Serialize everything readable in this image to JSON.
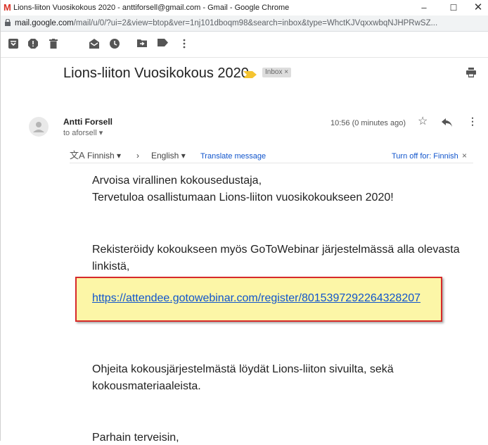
{
  "window": {
    "title": "Lions-liiton Vuosikokous 2020 - anttiforsell@gmail.com - Gmail - Google Chrome",
    "logo_letter": "M",
    "minimize": "–",
    "maximize": "☐",
    "close": "✕"
  },
  "address": {
    "domain": "mail.google.com",
    "path": "/mail/u/0/?ui=2&view=btop&ver=1nj101dboqm98&search=inbox&type=WhctKJVqxxwbqNJHPRwSZ..."
  },
  "toolbar": {
    "icons": [
      "archive-icon",
      "report-spam-icon",
      "delete-icon",
      "mark-unread-icon",
      "snooze-icon",
      "move-to-icon",
      "label-icon",
      "more-vert-icon"
    ]
  },
  "message": {
    "subject": "Lions-liiton Vuosikokous 2020",
    "label_chip": "Inbox ×",
    "sender": "Antti Forsell",
    "recipient": "to aforsell ▾",
    "time": "10:56 (0 minutes ago)",
    "star": "☆",
    "more": "⋮"
  },
  "translate": {
    "icon": "文A",
    "from_lang": "Finnish ▾",
    "arrow": "›",
    "to_lang": "English ▾",
    "translate_link": "Translate message",
    "turn_off": "Turn off for: Finnish",
    "close": "×"
  },
  "body": {
    "line1": "Arvoisa virallinen kokousedustaja,",
    "line2": "Tervetuloa osallistumaan Lions-liiton vuosikokoukseen 2020!",
    "line3": "Rekisteröidy kokoukseen myös GoToWebinar järjestelmässä alla olevasta",
    "line4": "linkistä,",
    "link": "https://attendee.gotowebinar.com/register/8015397292264328207",
    "line5": "Ohjeita kokousjärjestelmästä löydät Lions-liiton sivuilta, sekä",
    "line6": "kokousmateriaaleista.",
    "line7": "Parhain terveisin,"
  },
  "colors": {
    "link": "#1155cc",
    "highlight_fill": "#fcf6a7",
    "highlight_border": "#d72a2a",
    "importance_marker": "#f5c431"
  }
}
